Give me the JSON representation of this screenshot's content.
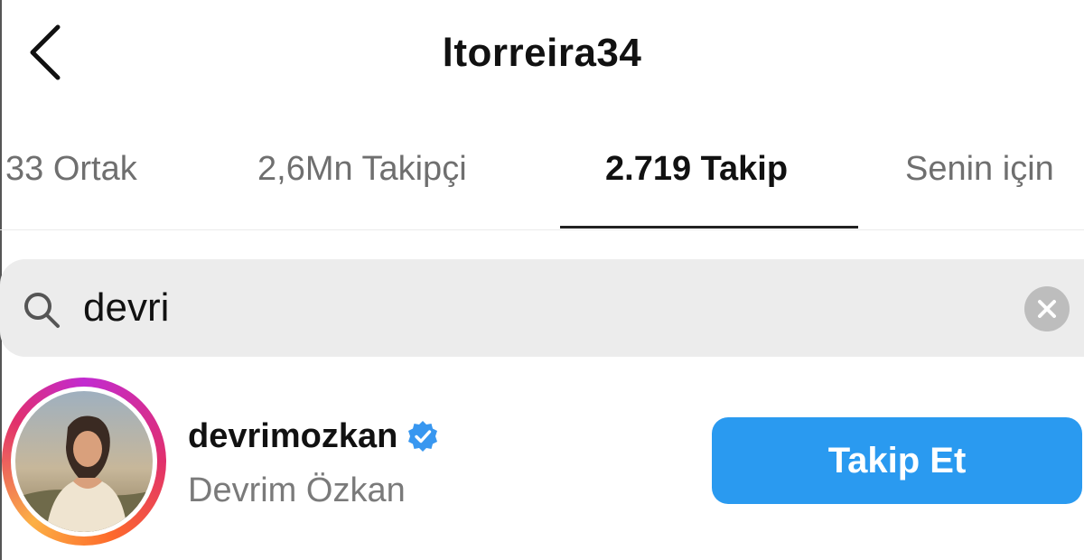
{
  "header": {
    "title": "ltorreira34"
  },
  "tabs": [
    {
      "label": "33 Ortak"
    },
    {
      "label": "2,6Mn Takipçi"
    },
    {
      "label": "2.719 Takip"
    },
    {
      "label": "Senin için"
    }
  ],
  "active_tab": "2.719 Takip",
  "search": {
    "value": "devri"
  },
  "result": {
    "username": "devrimozkan",
    "full_name": "Devrim Özkan",
    "verified": true,
    "follow_label": "Takip Et"
  },
  "colors": {
    "follow_button": "#2a9af0",
    "verified_badge": "#3897f0",
    "search_background": "#ececec",
    "story_ring": [
      "#c22ad0",
      "#e1306c",
      "#fcb045"
    ]
  },
  "icons": [
    "back-arrow-icon",
    "search-icon",
    "clear-icon",
    "verified-badge-icon"
  ]
}
